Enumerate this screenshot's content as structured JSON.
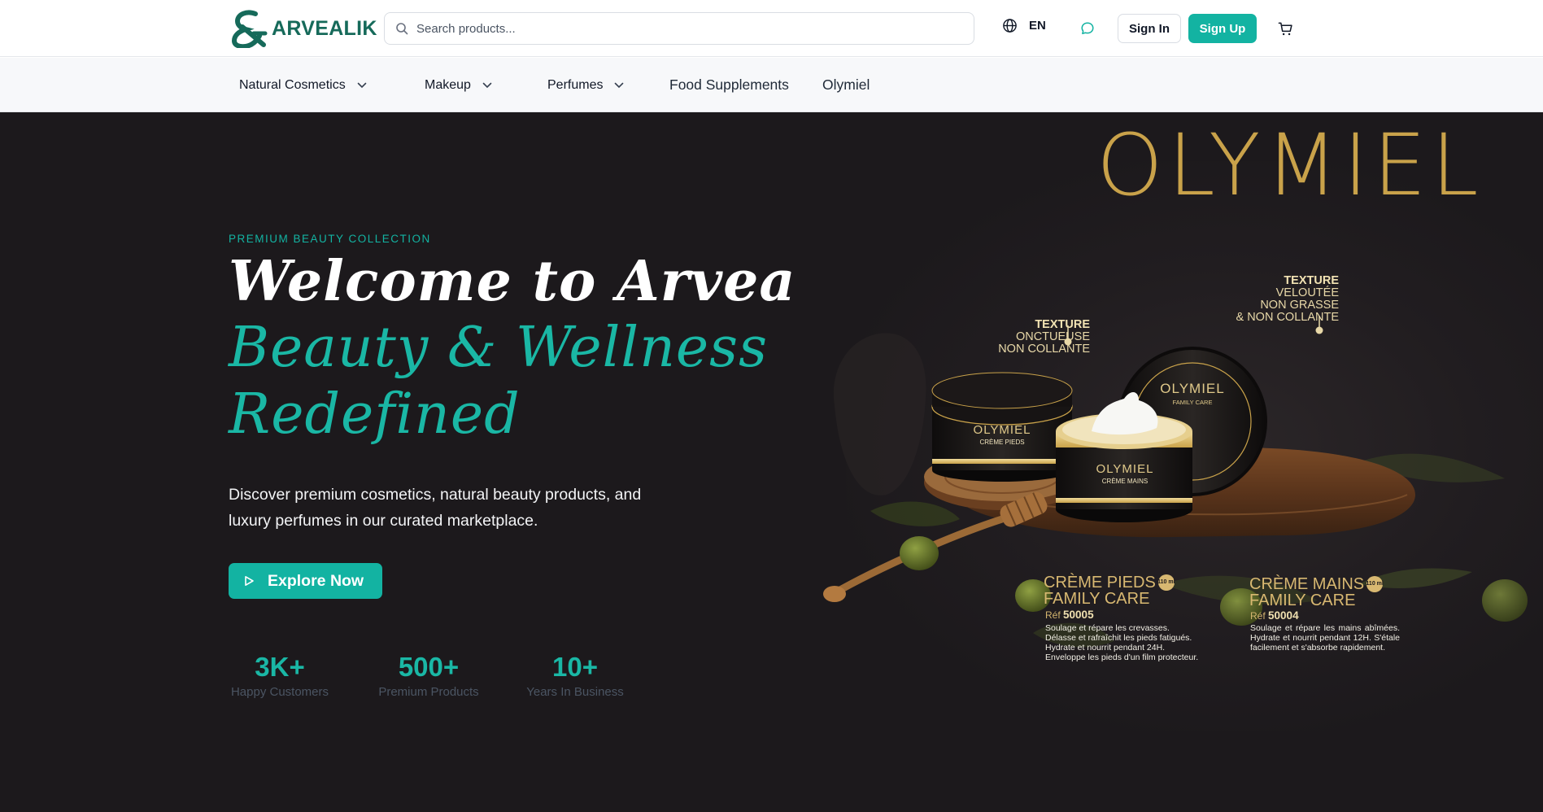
{
  "brand": {
    "name": "ARVEALIK",
    "color": "#166a5a",
    "accent": "#13b3a2"
  },
  "header": {
    "search": {
      "placeholder": "Search products..."
    },
    "language": "EN",
    "sign_in": "Sign In",
    "sign_up": "Sign Up",
    "icons": [
      "search-icon",
      "globe-icon",
      "chat-icon",
      "cart-icon"
    ]
  },
  "nav": {
    "items": [
      {
        "label": "Natural Cosmetics",
        "dropdown": true
      },
      {
        "label": "Makeup",
        "dropdown": true
      },
      {
        "label": "Perfumes",
        "dropdown": true
      },
      {
        "label": "Food Supplements",
        "dropdown": false
      },
      {
        "label": "Olymiel",
        "dropdown": false
      }
    ]
  },
  "hero": {
    "kicker": "PREMIUM BEAUTY COLLECTION",
    "headline_line1": "Welcome to Arvea",
    "headline_line2": "Beauty & Wellness",
    "headline_line3": "Redefined",
    "description": "Discover premium cosmetics, natural beauty products, and luxury perfumes in our curated marketplace.",
    "cta": "Explore Now",
    "stats": [
      {
        "value": "3K+",
        "label": "Happy Customers"
      },
      {
        "value": "500+",
        "label": "Premium Products"
      },
      {
        "value": "10+",
        "label": "Years In Business"
      }
    ]
  },
  "banner": {
    "logo_text": "OLYMIEL",
    "texture_left": {
      "title": "TEXTURE",
      "line2": "ONCTUEUSE",
      "line3": "NON COLLANTE"
    },
    "texture_right": {
      "title": "TEXTURE",
      "line2": "VELOUTÉE",
      "line3": "NON GRASSE",
      "line4": "& NON COLLANTE"
    },
    "jar_logo": "OLYMIEL",
    "jar_sub": "FAMILY CARE",
    "jar1_name": "CRÈME PIEDS",
    "jar2_name": "CRÈME MAINS",
    "badge": "110 ml",
    "product1": {
      "title1": "CRÈME PIEDS",
      "title2": "FAMILY CARE",
      "ref_label": "Réf",
      "ref": "50005",
      "desc": "Soulage et répare les crevasses. Délasse et rafraîchit les pieds fatigués. Hydrate et nourrit pendant 24H. Enveloppe les pieds d'un film protecteur."
    },
    "product2": {
      "title1": "CRÈME MAINS",
      "title2": "FAMILY CARE",
      "ref_label": "Réf",
      "ref": "50004",
      "desc": "Soulage et répare les mains abîmées. Hydrate et nourrit pendant 12H. S'étale facilement et s'absorbe rapidement."
    }
  }
}
